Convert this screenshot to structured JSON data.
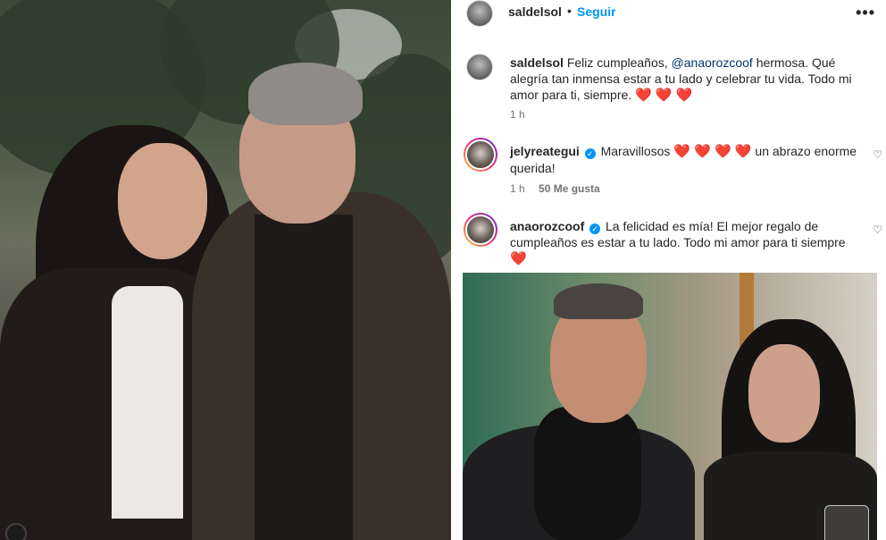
{
  "post": {
    "author": "saldelsol",
    "separator": "•",
    "follow_label": "Seguir",
    "more_label": "•••"
  },
  "caption": {
    "username": "saldelsol",
    "text_before": "Feliz cumpleaños, ",
    "mention": "@anaorozcoof",
    "text_after": " hermosa. Qué alegría tan inmensa estar a tu lado y celebrar tu vida. Todo mi amor para ti, siempre.",
    "hearts": "❤️ ❤️ ❤️",
    "time": "1 h"
  },
  "comments": [
    {
      "username": "jelyreategui",
      "verified": "✓",
      "text": "Maravillosos",
      "hearts": "❤️ ❤️ ❤️ ❤️",
      "text_after": "un abrazo enorme querida!",
      "time": "1 h",
      "likes": "50 Me gusta",
      "like_icon": "♡"
    },
    {
      "username": "anaorozcoof",
      "verified": "✓",
      "text": "La felicidad es mía! El mejor regalo de cumpleaños es estar a tu lado. Todo mi amor para ti siempre",
      "hearts": "❤️",
      "like_icon": "♡"
    }
  ],
  "icons": {
    "heart": "heart-icon",
    "verified": "verified-badge-icon",
    "like": "like-heart-outline-icon",
    "more": "more-options-icon"
  },
  "colors": {
    "follow_blue": "#0095f6",
    "text": "#262626",
    "muted": "#737373",
    "heart_red": "#ed1c24"
  }
}
